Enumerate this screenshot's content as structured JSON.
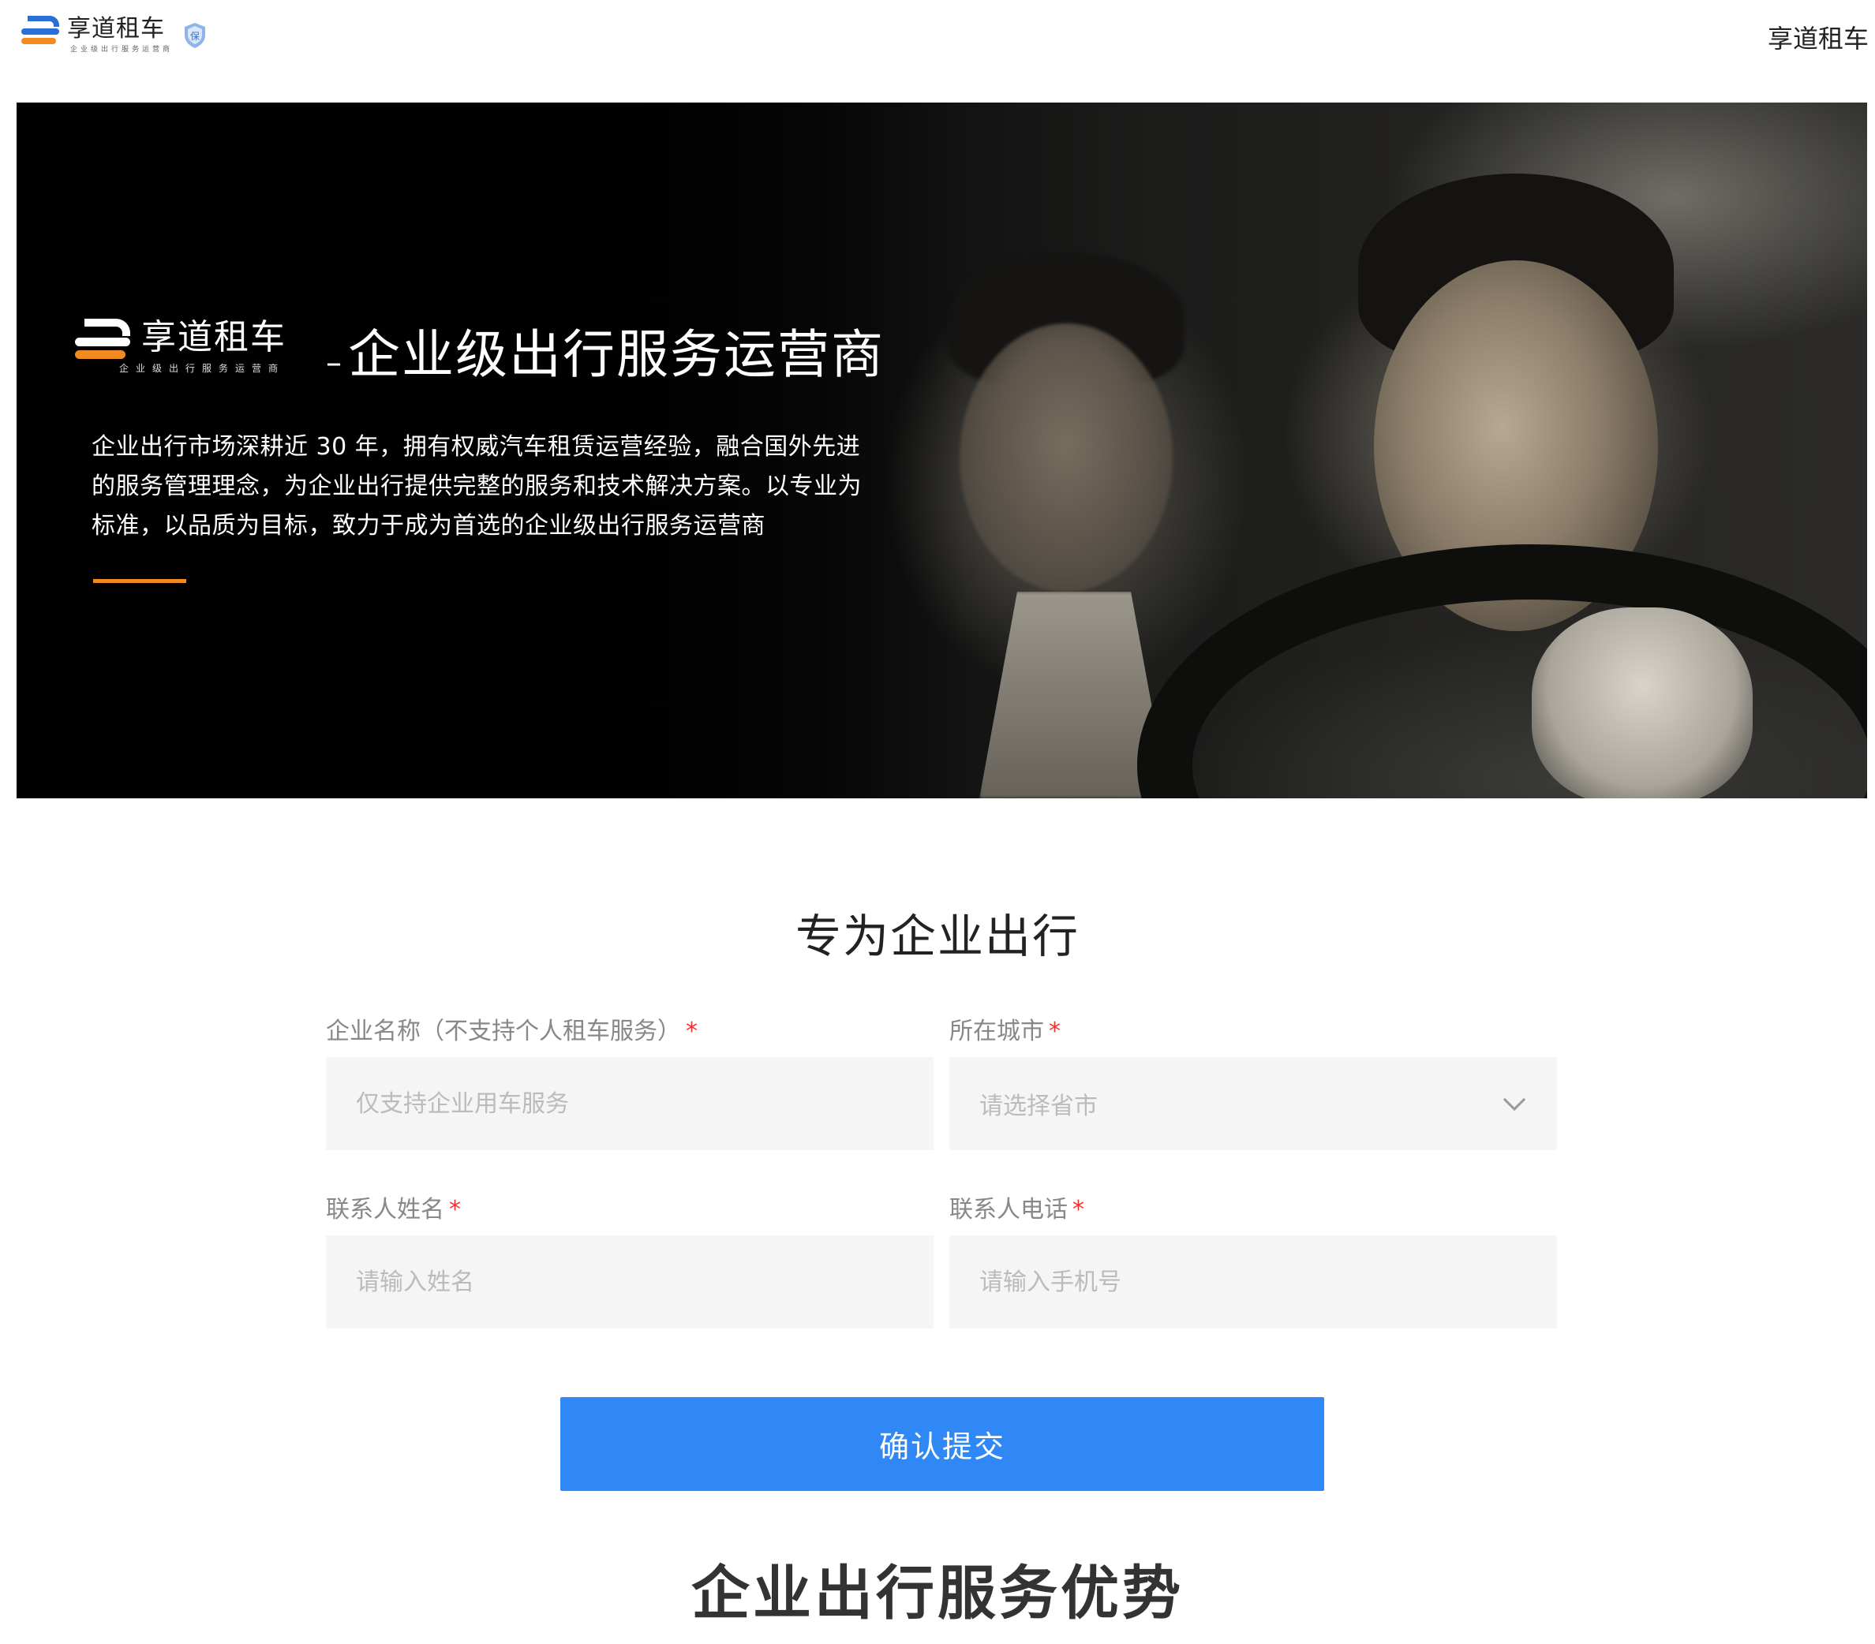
{
  "header": {
    "logo_name": "享道租车",
    "logo_sub": "企业级出行服务运营商",
    "badge_icon": "shield-badge-icon",
    "right_link": "享道租车"
  },
  "banner": {
    "logo_name": "享道租车",
    "logo_sub": "企业级出行服务运营商",
    "dash": "–",
    "title": "企业级出行服务运营商",
    "description": "企业出行市场深耕近 30 年，拥有权威汽车租赁运营经验，融合国外先进的服务管理理念，为企业出行提供完整的服务和技术解决方案。以专业为标准，以品质为目标，致力于成为首选的企业级出行服务运营商",
    "accent_color": "#f28a22"
  },
  "form": {
    "title": "专为企业出行",
    "company": {
      "label": "企业名称（不支持个人租车服务）",
      "required": "*",
      "placeholder": "仅支持企业用车服务",
      "value": ""
    },
    "city": {
      "label": "所在城市",
      "required": "*",
      "placeholder": "请选择省市"
    },
    "contact_name": {
      "label": "联系人姓名",
      "required": "*",
      "placeholder": "请输入姓名",
      "value": ""
    },
    "contact_phone": {
      "label": "联系人电话",
      "required": "*",
      "placeholder": "请输入手机号",
      "value": ""
    },
    "submit_label": "确认提交",
    "submit_color": "#2f88f5"
  },
  "advantages": {
    "title": "企业出行服务优势"
  }
}
